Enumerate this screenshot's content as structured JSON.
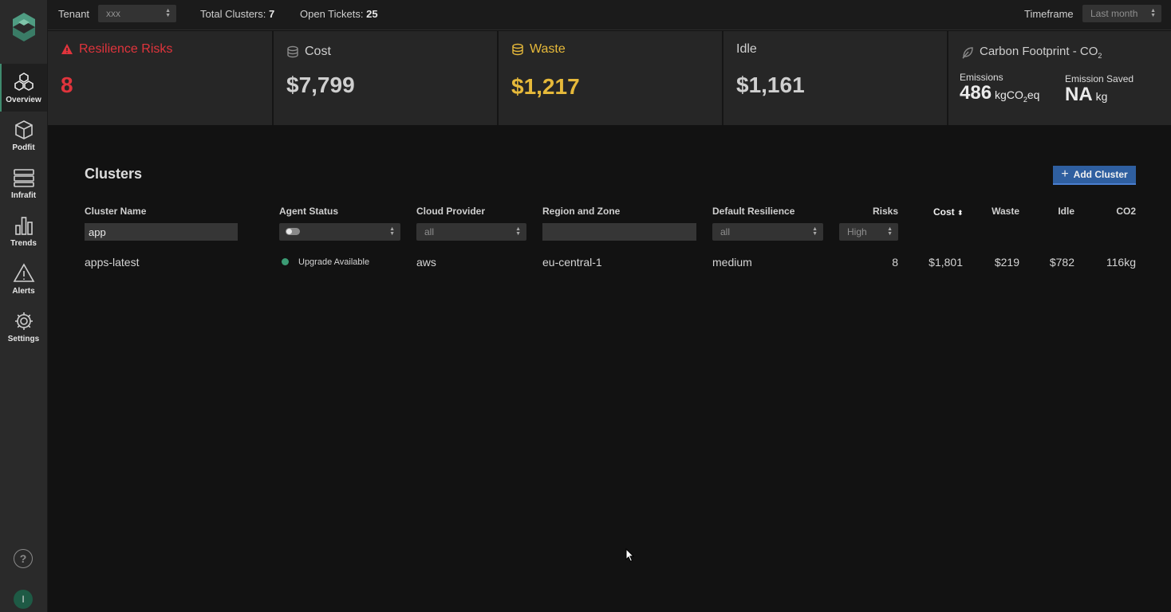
{
  "sidebar": {
    "items": [
      {
        "label": "Overview",
        "icon": "cubes-icon"
      },
      {
        "label": "Podfit",
        "icon": "cube-icon"
      },
      {
        "label": "Infrafit",
        "icon": "server-icon"
      },
      {
        "label": "Trends",
        "icon": "bar-chart-icon"
      },
      {
        "label": "Alerts",
        "icon": "warning-icon"
      },
      {
        "label": "Settings",
        "icon": "gear-icon"
      }
    ],
    "help": "?",
    "avatar_initial": "I"
  },
  "topbar": {
    "tenant_label": "Tenant",
    "tenant_value": "xxx",
    "total_clusters_label": "Total Clusters:",
    "total_clusters_value": "7",
    "open_tickets_label": "Open Tickets:",
    "open_tickets_value": "25",
    "timeframe_label": "Timeframe",
    "timeframe_value": "Last month"
  },
  "kpis": {
    "resilience": {
      "title": "Resilience Risks",
      "value": "8"
    },
    "cost": {
      "title": "Cost",
      "value": "$7,799"
    },
    "waste": {
      "title": "Waste",
      "value": "$1,217"
    },
    "idle": {
      "title": "Idle",
      "value": "$1,161"
    },
    "carbon": {
      "title": "Carbon Footprint - CO",
      "title_sub": "2",
      "emissions_label": "Emissions",
      "emissions_value": "486",
      "emissions_unit": "kgCO",
      "emissions_unit_sub": "2",
      "emissions_unit_suffix": "eq",
      "saved_label": "Emission Saved",
      "saved_value": "NA",
      "saved_unit": "kg"
    }
  },
  "clusters": {
    "title": "Clusters",
    "add_button": "Add Cluster",
    "columns": {
      "name": "Cluster Name",
      "agent": "Agent Status",
      "cloud": "Cloud Provider",
      "region": "Region and Zone",
      "resilience": "Default Resilience",
      "risks": "Risks",
      "cost": "Cost",
      "waste": "Waste",
      "idle": "Idle",
      "co2": "CO2"
    },
    "filters": {
      "name": "app",
      "cloud": "all",
      "region": "",
      "resilience": "all",
      "risks": "High"
    },
    "rows": [
      {
        "name": "apps-latest",
        "agent_status": "Upgrade Available",
        "cloud": "aws",
        "region": "eu-central-1",
        "resilience": "medium",
        "risks": "8",
        "cost": "$1,801",
        "waste": "$219",
        "idle": "$782",
        "co2": "116kg"
      }
    ]
  },
  "colors": {
    "accent_red": "#e0343c",
    "accent_gold": "#e6b93a",
    "status_green": "#3b9b74",
    "button_blue": "#2f5fa0"
  }
}
